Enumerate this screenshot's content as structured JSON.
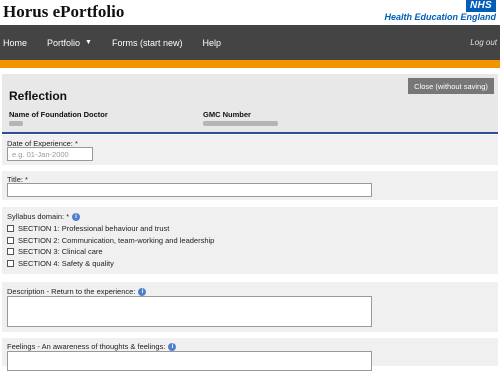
{
  "app": {
    "title": "Horus ePortfolio",
    "brand_logo": "NHS",
    "brand_name": "Health Education England"
  },
  "nav": {
    "items": [
      "Home",
      "Portfolio",
      "Forms (start new)",
      "Help"
    ],
    "logout": "Log out"
  },
  "header": {
    "close_button": "Close (without saving)",
    "page_title": "Reflection",
    "doctor_label": "Name of Foundation Doctor",
    "gmc_label": "GMC Number"
  },
  "form": {
    "date_label": "Date of Experience: *",
    "date_placeholder": "e.g. 01-Jan-2000",
    "title_label": "Title: *",
    "syllabus_label": "Syllabus domain: *",
    "syllabus_options": [
      "SECTION 1: Professional behaviour and trust",
      "SECTION 2: Communication, team-working and leadership",
      "SECTION 3: Clinical care",
      "SECTION 4: Safety & quality"
    ],
    "description_label": "Description - Return to the experience:",
    "feelings_label": "Feelings - An awareness of thoughts & feelings:"
  },
  "colors": {
    "navbar": "#444444",
    "accent_strip": "#f29400",
    "nhs_blue": "#005eb8",
    "header_underline": "#2b4f9a"
  }
}
